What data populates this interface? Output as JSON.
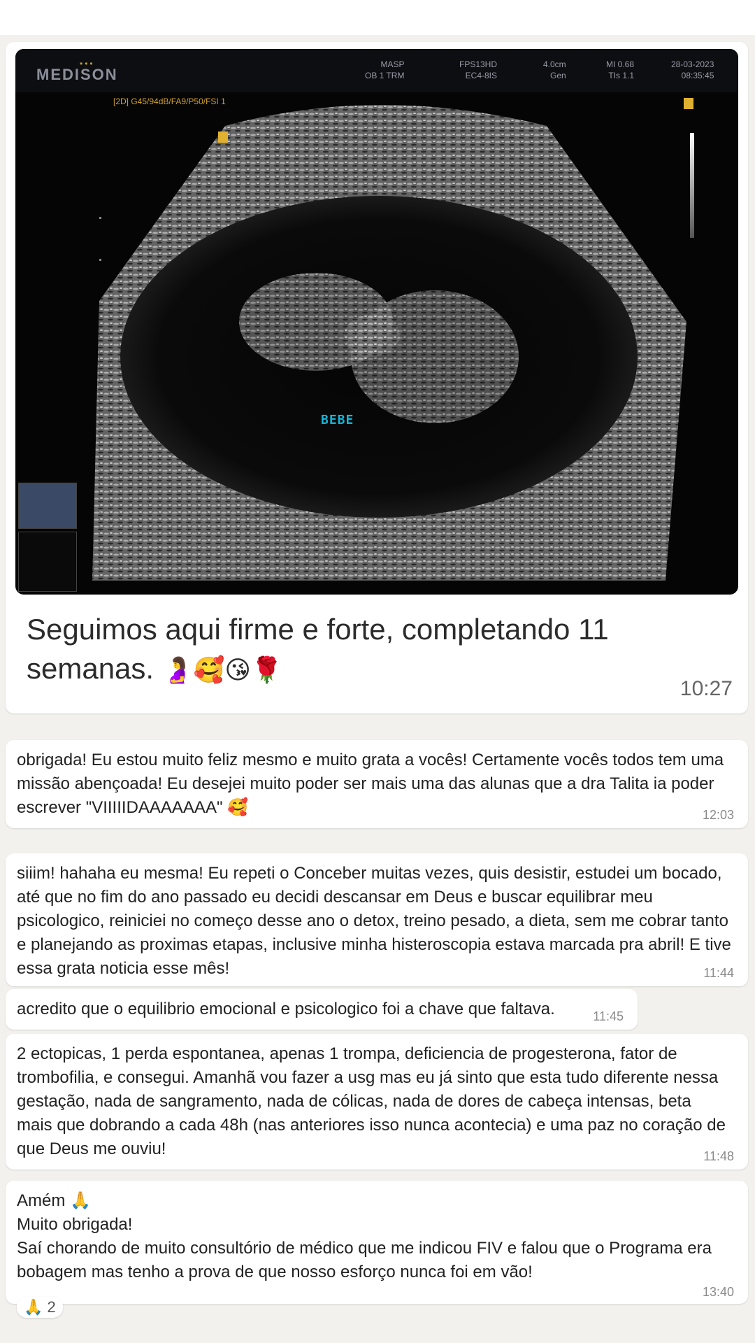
{
  "image_message": {
    "ultrasound": {
      "brand": "MEDISON",
      "header_1": "MASP\nOB 1 TRM",
      "header_2": "FPS13HD\nEC4-8IS",
      "header_3": "4.0cm\nGen",
      "header_4": "MI 0.68\nTIs 1.1",
      "header_5": "28-03-2023\n08:35:45",
      "probe_info": "[2D] G45/94dB/FA9/P50/FSI 1",
      "label": "BEBE"
    },
    "caption": "Seguimos aqui firme e forte, completando 11 semanas.",
    "caption_emojis": "🤰🥰😘🌹",
    "time": "10:27"
  },
  "messages": [
    {
      "text": "obrigada! Eu estou muito feliz mesmo e muito grata a vocês! Certamente vocês todos tem uma missão abençoada! Eu desejei muito poder ser mais uma das alunas que a dra Talita ia poder escrever \"VIIIIIDAAAAAAA\" 🥰",
      "time": "12:03"
    },
    {
      "text": "siiim! hahaha eu mesma! Eu repeti o Conceber muitas vezes, quis desistir, estudei um bocado, até que no fim do ano passado eu decidi descansar em Deus e buscar equilibrar meu psicologico, reiniciei no começo desse ano o detox, treino pesado, a dieta, sem me cobrar tanto e planejando as proximas etapas, inclusive minha histeroscopia estava marcada pra abril! E tive essa grata noticia esse mês!",
      "time": "11:44"
    },
    {
      "text": "acredito que o equilibrio emocional e psicologico foi a chave que faltava.",
      "time": "11:45"
    },
    {
      "text": "2 ectopicas, 1 perda espontanea, apenas 1 trompa, deficiencia de progesterona, fator de trombofilia, e consegui. Amanhã vou fazer a usg mas eu já sinto que esta tudo diferente nessa gestação, nada de sangramento, nada de cólicas, nada de dores de cabeça intensas, beta mais que dobrando a cada 48h (nas anteriores isso nunca acontecia) e uma paz no coração de que Deus me ouviu!",
      "time": "11:48"
    },
    {
      "line1": "Amém 🙏",
      "line2": "Muito obrigada!",
      "line3": "Saí chorando de muito consultório de médico que me indicou FIV e falou que o Programa era bobagem mas tenho a prova de que nosso esforço nunca foi em vão!",
      "time": "13:40",
      "reaction": "🙏 2"
    }
  ]
}
